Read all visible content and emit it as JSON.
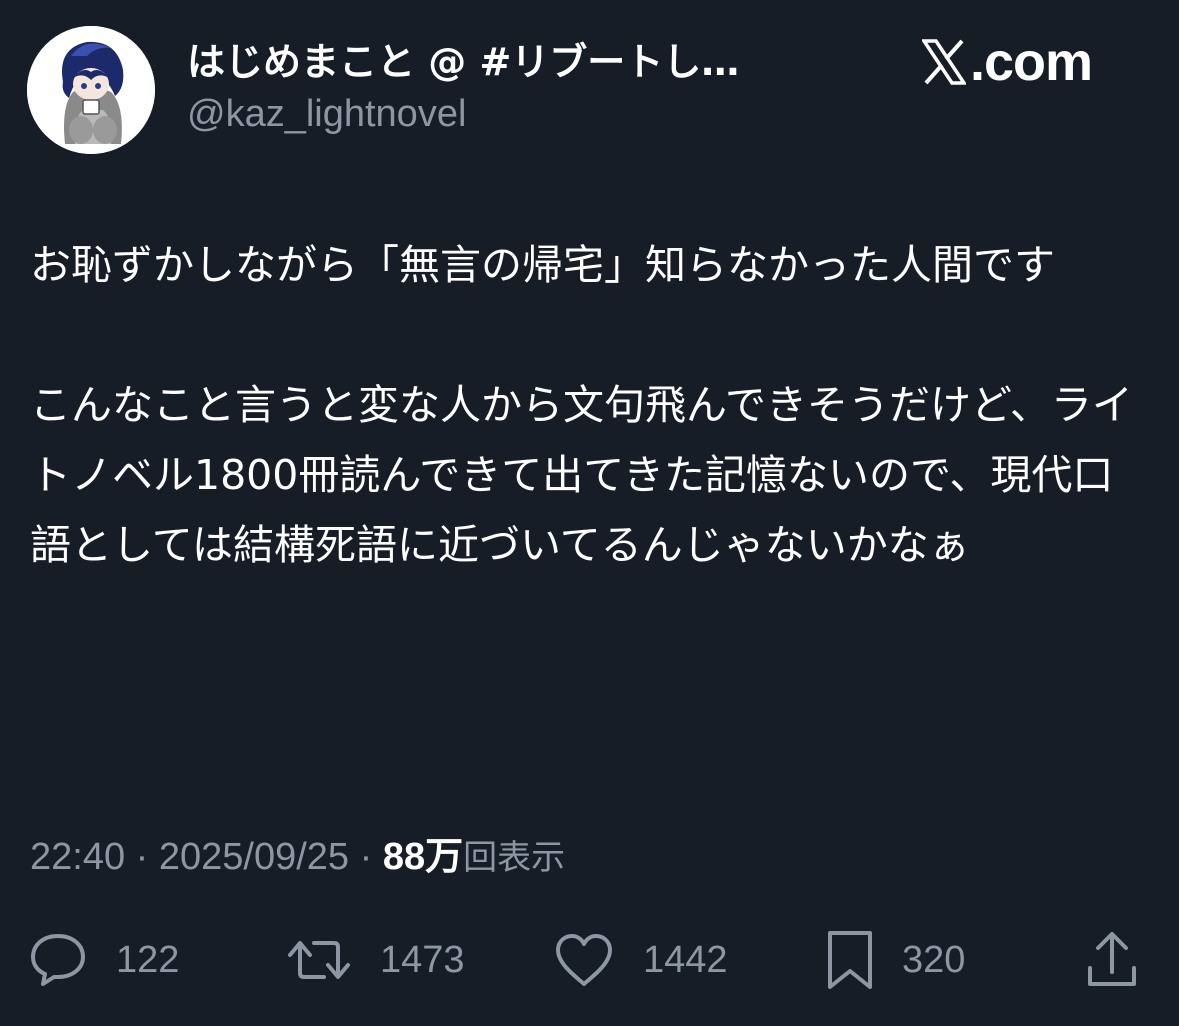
{
  "header": {
    "display_name": "はじめまこと @ #リブートし…",
    "handle": "@kaz_lightnovel",
    "brand": "com",
    "brand_prefix": ".",
    "brand_icon": "x-logo-icon"
  },
  "tweet": {
    "paragraphs": [
      "お恥ずかしながら「無言の帰宅」知らなかった人間です",
      "こんなこと言うと変な人から文句飛んできそうだけど、ライトノベル1800冊読んできて出てきた記憶ないので、現代口語としては結構死語に近づいてるんじゃないかなぁ"
    ]
  },
  "meta": {
    "time": "22:40",
    "separator": "·",
    "date": "2025/09/25",
    "views_count": "88万",
    "views_label": "回表示"
  },
  "actions": {
    "replies": {
      "icon": "reply-icon",
      "count": "122"
    },
    "reposts": {
      "icon": "repost-icon",
      "count": "1473"
    },
    "likes": {
      "icon": "heart-icon",
      "count": "1442"
    },
    "bookmarks": {
      "icon": "bookmark-icon",
      "count": "320"
    },
    "share": {
      "icon": "share-icon"
    }
  },
  "colors": {
    "background": "#171d27",
    "text": "#ffffff",
    "secondary": "#8e96a3"
  }
}
